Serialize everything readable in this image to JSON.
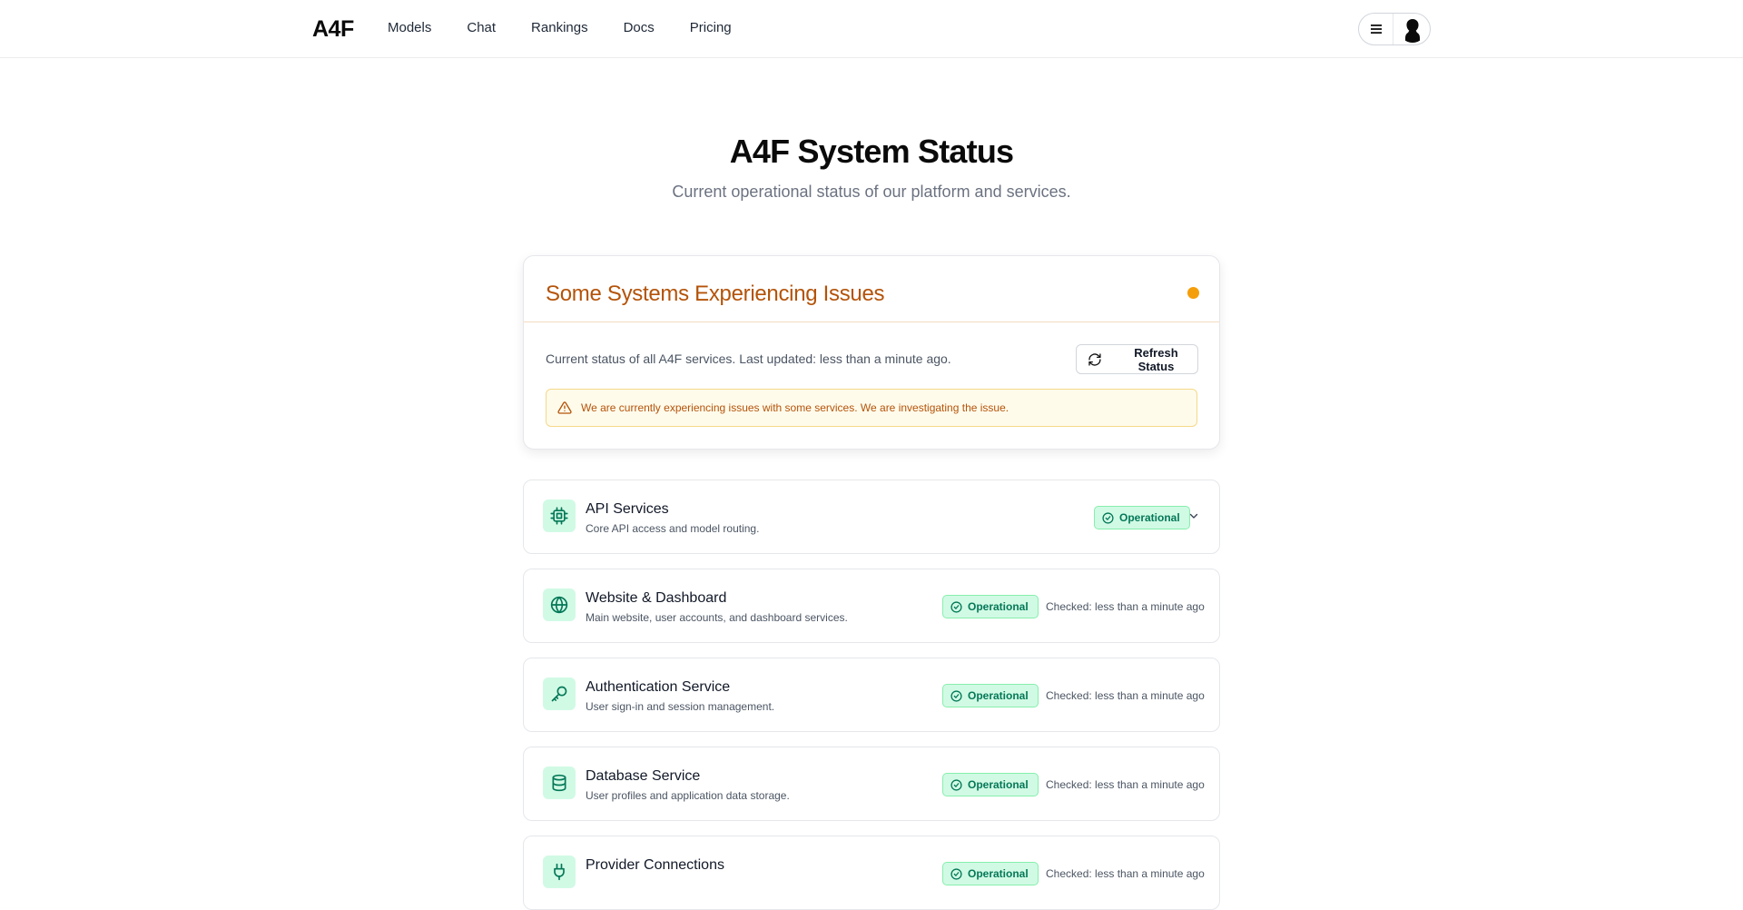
{
  "nav": {
    "logo": "A4F",
    "links": [
      "Models",
      "Chat",
      "Rankings",
      "Docs",
      "Pricing"
    ]
  },
  "hero": {
    "title": "A4F System Status",
    "subtitle": "Current operational status of our platform and services."
  },
  "overall": {
    "title": "Some Systems Experiencing Issues",
    "description": "Current status of all A4F services. Last updated: less than a minute ago.",
    "refresh_label": "Refresh Status",
    "alert": "We are currently experiencing issues with some services. We are investigating the issue.",
    "status_color": "#f59e0b"
  },
  "services": [
    {
      "name": "API Services",
      "description": "Core API access and model routing.",
      "status": "Operational",
      "checked": "",
      "icon": "cpu-icon"
    },
    {
      "name": "Website & Dashboard",
      "description": "Main website, user accounts, and dashboard services.",
      "status": "Operational",
      "checked": "Checked: less than a minute ago",
      "icon": "globe-icon"
    },
    {
      "name": "Authentication Service",
      "description": "User sign-in and session management.",
      "status": "Operational",
      "checked": "Checked: less than a minute ago",
      "icon": "key-icon"
    },
    {
      "name": "Database Service",
      "description": "User profiles and application data storage.",
      "status": "Operational",
      "checked": "Checked: less than a minute ago",
      "icon": "database-icon"
    },
    {
      "name": "Provider Connections",
      "description": "",
      "status": "Operational",
      "checked": "Checked: less than a minute ago",
      "icon": "plug-icon"
    }
  ],
  "colors": {
    "operational_bg": "#d1fae5",
    "operational_text": "#047857",
    "warning_text": "#b45309",
    "warning_bg": "#fffbeb"
  }
}
